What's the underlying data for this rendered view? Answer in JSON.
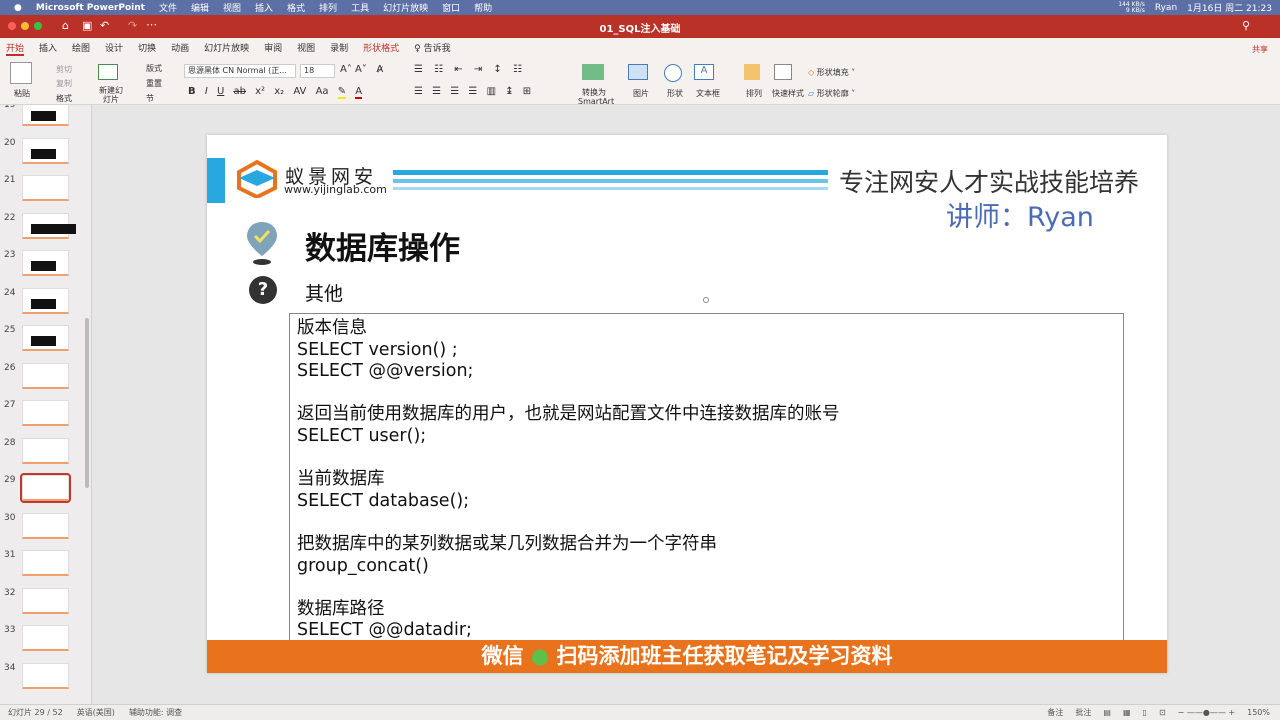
{
  "menubar": {
    "app": "Microsoft PowerPoint",
    "items": [
      "文件",
      "编辑",
      "视图",
      "插入",
      "格式",
      "排列",
      "工具",
      "幻灯片放映",
      "窗口",
      "帮助"
    ],
    "net_up": "144 KB/s",
    "net_down": "9 KB/s",
    "user": "Ryan",
    "datetime": "1月16日 周二 21:23"
  },
  "titlebar": {
    "doc_title": "01_SQL注入基础"
  },
  "ribbon": {
    "tabs": [
      "开始",
      "插入",
      "绘图",
      "设计",
      "切换",
      "动画",
      "幻灯片放映",
      "审阅",
      "视图",
      "录制",
      "形状格式",
      "告诉我"
    ],
    "share": "共享",
    "paste": "粘贴",
    "cut": "剪切",
    "copy": "复制",
    "format": "格式",
    "new_slide": "新建幻灯片",
    "layout": "版式",
    "reset": "重置",
    "section": "节",
    "font": "思源黑体 CN Normal (正...",
    "size": "18",
    "smartart": "转换为SmartArt",
    "picture": "图片",
    "shape": "形状",
    "textbox": "文本框",
    "arrange": "排列",
    "quick_styles": "快速样式",
    "shape_fill": "形状填充",
    "shape_outline": "形状轮廓"
  },
  "thumbnails": [
    {
      "n": "19"
    },
    {
      "n": "20"
    },
    {
      "n": "21"
    },
    {
      "n": "22"
    },
    {
      "n": "23"
    },
    {
      "n": "24"
    },
    {
      "n": "25"
    },
    {
      "n": "26"
    },
    {
      "n": "27"
    },
    {
      "n": "28"
    },
    {
      "n": "29",
      "selected": true
    },
    {
      "n": "30"
    },
    {
      "n": "31"
    },
    {
      "n": "32"
    },
    {
      "n": "33"
    },
    {
      "n": "34"
    }
  ],
  "slide": {
    "brand": "蚁景网安",
    "url": "www.yijinglab.com",
    "slogan": "专注网安人才实战技能培养",
    "lecturer": "讲师：Ryan",
    "title": "数据库操作",
    "subtitle": "其他",
    "lines": [
      "版本信息",
      "SELECT version() ;",
      "SELECT @@version;",
      "",
      "返回当前使用数据库的用户，也就是网站配置文件中连接数据库的账号",
      "SELECT user();",
      "",
      "当前数据库",
      "SELECT database();",
      "",
      "把数据库中的某列数据或某几列数据合并为一个字符串",
      "group_concat()",
      "",
      "数据库路径",
      "SELECT @@datadir;"
    ],
    "footer_wechat": "微信",
    "footer_text": "扫码添加班主任获取笔记及学习资料",
    "accent": "#e8731c",
    "blue": "#29a8e0"
  },
  "status": {
    "slide_count": "幻灯片 29 / 52",
    "language": "英语(美国)",
    "accessibility": "辅助功能: 调查",
    "notes": "备注",
    "comments": "批注",
    "zoom": "150%"
  }
}
